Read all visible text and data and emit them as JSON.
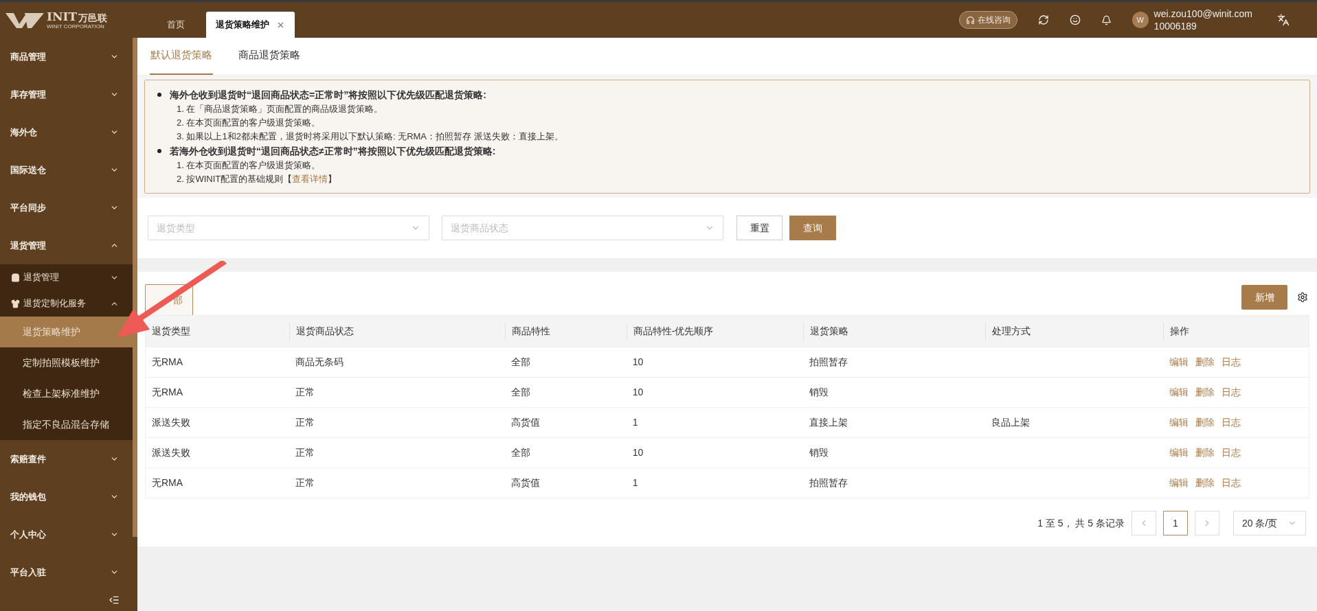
{
  "logo": {
    "mark": "INIT",
    "name": "万邑联",
    "subtitle": "WINIT CORPORATION"
  },
  "top_tabs": [
    {
      "label": "首页",
      "selected": false,
      "closable": false
    },
    {
      "label": "退货策略维护",
      "selected": true,
      "closable": true
    }
  ],
  "header": {
    "consult": "在线咨询",
    "avatar": "W",
    "email": "wei.zou100@winit.com",
    "account": "10006189"
  },
  "sidebar": {
    "items": [
      {
        "label": "商品管理",
        "expanded": false
      },
      {
        "label": "库存管理",
        "expanded": false
      },
      {
        "label": "海外仓",
        "expanded": false
      },
      {
        "label": "国际送仓",
        "expanded": false
      },
      {
        "label": "平台同步",
        "expanded": false
      },
      {
        "label": "退货管理",
        "expanded": true,
        "children": [
          {
            "label": "退货管理",
            "expanded": false
          },
          {
            "label": "退货定制化服务",
            "expanded": true,
            "children": [
              {
                "label": "退货策略维护",
                "selected": true
              },
              {
                "label": "定制拍照模板维护",
                "selected": false
              },
              {
                "label": "检查上架标准维护",
                "selected": false
              },
              {
                "label": "指定不良品混合存储",
                "selected": false
              }
            ]
          }
        ]
      },
      {
        "label": "索赔查件",
        "expanded": false
      },
      {
        "label": "我的钱包",
        "expanded": false
      },
      {
        "label": "个人中心",
        "expanded": false
      },
      {
        "label": "平台入驻",
        "expanded": false
      }
    ]
  },
  "page_tabs": [
    {
      "label": "默认退货策略",
      "selected": true
    },
    {
      "label": "商品退货策略",
      "selected": false
    }
  ],
  "notice": [
    {
      "kind": "heading",
      "text": "海外仓收到退货时“退回商品状态=正常时”将按照以下优先级匹配退货策略:"
    },
    {
      "kind": "line",
      "text": "1. 在「商品退货策略」页面配置的商品级退货策略。"
    },
    {
      "kind": "line",
      "text": "2. 在本页面配置的客户级退货策略。"
    },
    {
      "kind": "line",
      "text": "3. 如果以上1和2都未配置，退货时将采用以下默认策略: 无RMA：拍照暂存 派送失败：直接上架。"
    },
    {
      "kind": "heading",
      "text": "若海外仓收到退货时“退回商品状态≠正常时”将按照以下优先级匹配退货策略:"
    },
    {
      "kind": "line",
      "text": "1. 在本页面配置的客户级退货策略。"
    },
    {
      "kind": "link_line",
      "text": "2. 按WINIT配置的基础规则【",
      "link": "查看详情",
      "after": "】"
    }
  ],
  "filters": [
    {
      "placeholder": "退货类型"
    },
    {
      "placeholder": "退货商品状态"
    }
  ],
  "buttons": {
    "reset": "重置",
    "search": "查询",
    "add": "新增"
  },
  "list_tabs": [
    {
      "label": "部",
      "selected": true
    }
  ],
  "table": {
    "columns": [
      "退货类型",
      "退货商品状态",
      "商品特性",
      "商品特性-优先顺序",
      "退货策略",
      "处理方式",
      "操作"
    ],
    "rows": [
      {
        "cells": [
          "无RMA",
          "商品无条码",
          "全部",
          "10",
          "拍照暂存",
          ""
        ],
        "actions": [
          "编辑",
          "删除",
          "日志"
        ]
      },
      {
        "cells": [
          "无RMA",
          "正常",
          "全部",
          "10",
          "销毁",
          ""
        ],
        "actions": [
          "编辑",
          "删除",
          "日志"
        ]
      },
      {
        "cells": [
          "派送失败",
          "正常",
          "高货值",
          "1",
          "直接上架",
          "良品上架"
        ],
        "actions": [
          "编辑",
          "删除",
          "日志"
        ]
      },
      {
        "cells": [
          "派送失败",
          "正常",
          "全部",
          "10",
          "销毁",
          ""
        ],
        "actions": [
          "编辑",
          "删除",
          "日志"
        ]
      },
      {
        "cells": [
          "无RMA",
          "正常",
          "高货值",
          "1",
          "拍照暂存",
          ""
        ],
        "actions": [
          "编辑",
          "删除",
          "日志"
        ]
      }
    ]
  },
  "pagination": {
    "summary": "1 至 5， 共 5 条记录",
    "pages": [
      {
        "label": "1",
        "selected": true
      }
    ],
    "page_size": "20 条/页"
  }
}
